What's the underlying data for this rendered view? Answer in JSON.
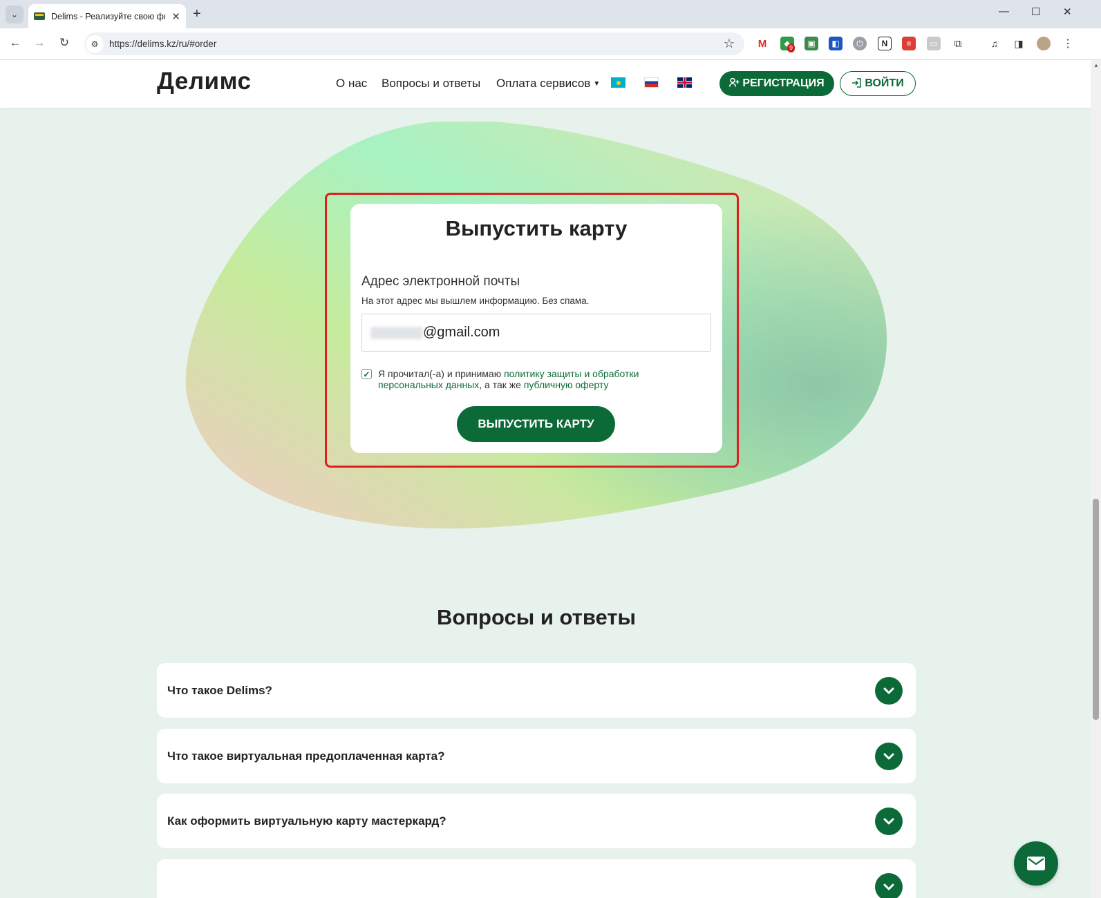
{
  "browser": {
    "tab_title": "Delims - Реализуйте свою фи",
    "url": "https://delims.kz/ru/#order",
    "extension_badge": "9"
  },
  "header": {
    "logo": "Делимс",
    "nav": [
      "О нас",
      "Вопросы и ответы",
      "Оплата сервисов"
    ],
    "register_label": "РЕГИСТРАЦИЯ",
    "login_label": "ВОЙТИ"
  },
  "order_form": {
    "title": "Выпустить карту",
    "email_label": "Адрес электронной почты",
    "email_hint": "На этот адрес мы вышлем информацию. Без спама.",
    "email_value_visible": "@gmail.com",
    "consent_prefix": "Я прочитал(-а) и принимаю ",
    "consent_link_policy": "политику защиты и обработки персональных данных",
    "consent_middle": ", а так же ",
    "consent_link_offer": "публичную оферту",
    "consent_checked": true,
    "submit_label": "ВЫПУСТИТЬ КАРТУ"
  },
  "faq": {
    "title": "Вопросы и ответы",
    "items": [
      "Что такое Delims?",
      "Что такое виртуальная предоплаченная карта?",
      "Как оформить виртуальную карту мастеркард?"
    ]
  },
  "colors": {
    "brand_green": "#0b6a38",
    "page_bg": "#e8f2ed",
    "highlight_red": "#e11d1d"
  }
}
